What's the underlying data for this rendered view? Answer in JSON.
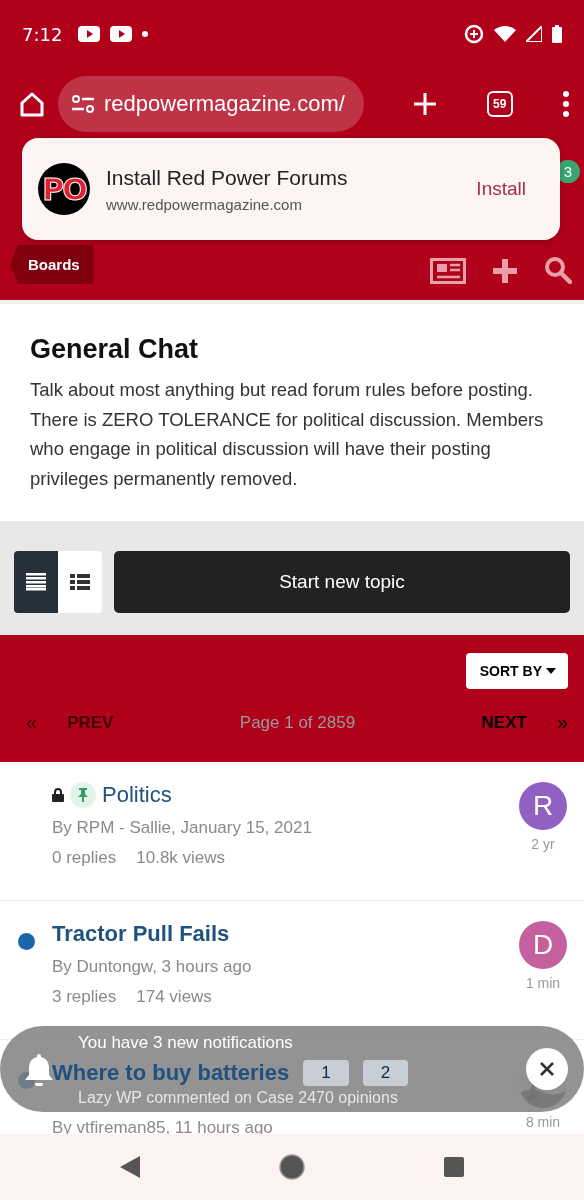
{
  "status_bar": {
    "time": "7:12"
  },
  "browser": {
    "url": "redpowermagazine.com/",
    "tab_count": "59"
  },
  "install_prompt": {
    "logo_text": "PO",
    "title": "Install Red Power Forums",
    "domain": "www.redpowermagazine.com",
    "button": "Install"
  },
  "site_header": {
    "badge": "3",
    "breadcrumb": "Boards"
  },
  "forum": {
    "title": "General Chat",
    "description": "Talk about most anything but read forum rules before posting. There is ZERO TOLERANCE for political discussion. Members who engage in political discussion will have their posting privileges permanently removed."
  },
  "view_toggle": [
    {
      "kind": "table",
      "selected": true
    },
    {
      "kind": "list",
      "selected": false
    }
  ],
  "new_topic_button": "Start new topic",
  "pagination": {
    "sort": "SORT BY",
    "prev_icon": "«",
    "prev": "PREV",
    "prev_disabled": true,
    "page": "Page 1 of 2859",
    "next": "NEXT",
    "next_icon": "»"
  },
  "topics": [
    {
      "title": "Politics",
      "locked": true,
      "pinned": true,
      "unread": false,
      "byline": "By RPM - Sallie, January 15, 2021",
      "replies": "0 replies",
      "views": "10.8k views",
      "avatar": {
        "kind": "letter",
        "letter": "R",
        "color": "#9061c2"
      },
      "time": "2 yr"
    },
    {
      "title": "Tractor Pull Fails",
      "locked": false,
      "pinned": false,
      "unread": true,
      "byline": "By Duntongw, 3 hours ago",
      "replies": "3 replies",
      "views": "174 views",
      "avatar": {
        "kind": "letter",
        "letter": "D",
        "color": "#c4609e"
      },
      "time": "1 min"
    },
    {
      "title": "Where to buy batteries",
      "locked": false,
      "pinned": false,
      "unread": true,
      "pages": [
        "1",
        "2"
      ],
      "byline": "By vtfireman85, 11 hours ago",
      "avatar": {
        "kind": "picture"
      },
      "time": "8 min"
    }
  ],
  "toast": {
    "title": "You have 3 new notifications",
    "message": "Lazy WP commented on Case 2470 opinions"
  }
}
